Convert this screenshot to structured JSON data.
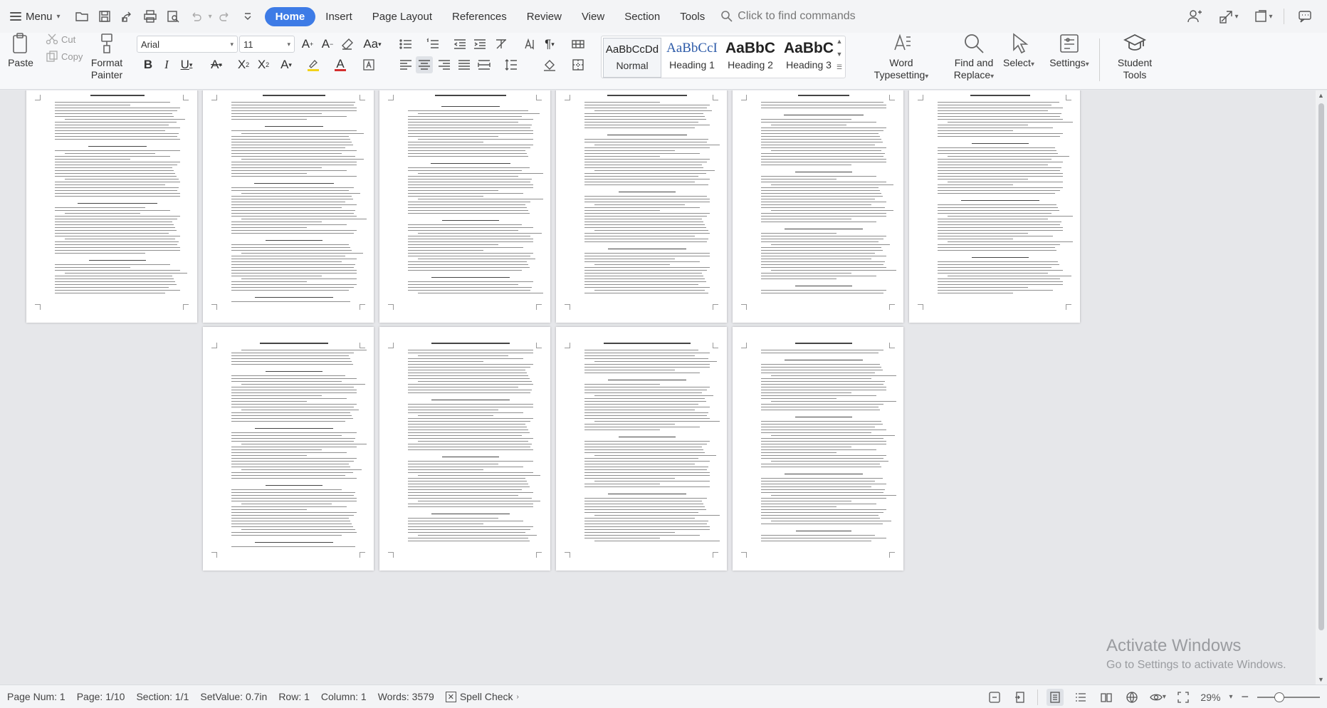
{
  "menubar": {
    "menu_label": "Menu",
    "tabs": [
      {
        "label": "Home",
        "active": true
      },
      {
        "label": "Insert"
      },
      {
        "label": "Page Layout"
      },
      {
        "label": "References"
      },
      {
        "label": "Review"
      },
      {
        "label": "View"
      },
      {
        "label": "Section"
      },
      {
        "label": "Tools"
      }
    ],
    "find_commands_placeholder": "Click to find commands"
  },
  "ribbon": {
    "clipboard": {
      "paste_label": "Paste",
      "cut_label": "Cut",
      "copy_label": "Copy",
      "format_painter_label": "Format Painter"
    },
    "font": {
      "family": "Arial",
      "size": "11"
    },
    "styles": [
      {
        "preview": "AaBbCcDd",
        "name": "Normal"
      },
      {
        "preview": "AaBbCcI",
        "name": "Heading 1"
      },
      {
        "preview": "AaBbC",
        "name": "Heading 2"
      },
      {
        "preview": "AaBbC",
        "name": "Heading 3"
      }
    ],
    "word_typesetting_label": "Word Typesetting",
    "find_replace_label": "Find and Replace",
    "select_label": "Select",
    "settings_label": "Settings",
    "student_tools_label": "Student Tools"
  },
  "statusbar": {
    "page_num": "Page Num: 1",
    "page": "Page: 1/10",
    "section": "Section: 1/1",
    "set_value": "SetValue: 0.7in",
    "row": "Row: 1",
    "column": "Column: 1",
    "words": "Words: 3579",
    "spell_check": "Spell Check",
    "zoom": "29%"
  },
  "watermark": {
    "line1": "Activate Windows",
    "line2": "Go to Settings to activate Windows."
  },
  "colors": {
    "accent": "#3d7be6",
    "highlight": "#f2d21a",
    "font_color": "#d42f2f"
  }
}
